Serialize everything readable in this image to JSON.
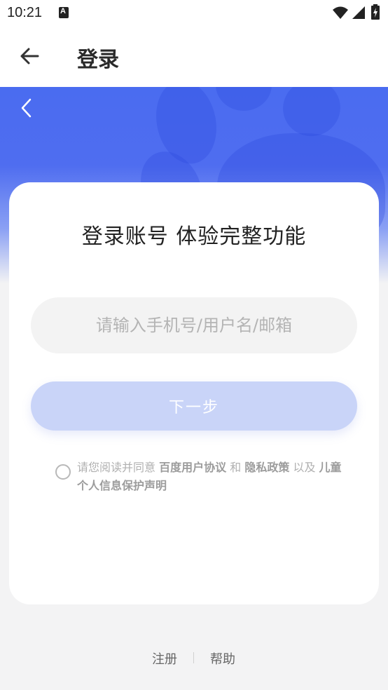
{
  "status_bar": {
    "time": "10:21",
    "icons": [
      "a-notification-icon",
      "wifi-icon",
      "signal-icon",
      "battery-charging-icon"
    ]
  },
  "app_bar": {
    "title": "登录",
    "back_icon": "arrow-left-icon"
  },
  "hero": {
    "back_icon": "chevron-left-icon",
    "color": "#4a6cf0"
  },
  "login_card": {
    "title": "登录账号 体验完整功能",
    "account_input": {
      "value": "",
      "placeholder": "请输入手机号/用户名/邮箱"
    },
    "next_button_label": "下一步",
    "agreement": {
      "prefix": "请您阅读并同意",
      "link_user_agreement": "百度用户协议",
      "and": "和",
      "link_privacy_policy": "隐私政策",
      "also": "以及",
      "link_children_privacy": "儿童个人信息保护声明",
      "checked": false
    }
  },
  "footer": {
    "register_label": "注册",
    "help_label": "帮助"
  },
  "colors": {
    "brand_blue": "#4a6cf0",
    "disabled_button": "#c9d4f8",
    "background": "#f3f3f4"
  }
}
